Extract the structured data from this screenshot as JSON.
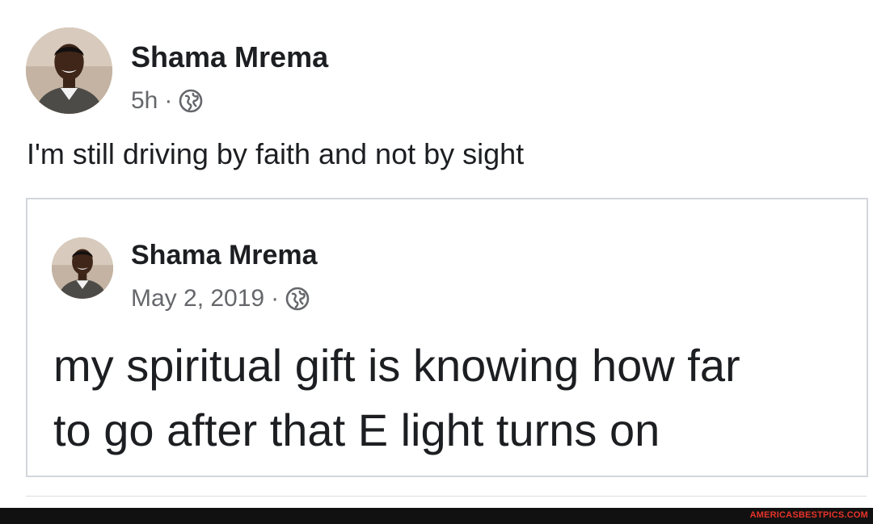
{
  "post": {
    "author": "Shama Mrema",
    "time": "5h",
    "separator": "·",
    "privacy_icon": "globe-icon",
    "text": "I'm still driving by faith and not by sight",
    "shared": {
      "author": "Shama Mrema",
      "date": "May 2, 2019",
      "separator": "·",
      "privacy_icon": "globe-icon",
      "text_lines": [
        "my spiritual gift is knowing how far",
        "to go after that E light turns on"
      ]
    }
  },
  "watermark": "AMERICASBESTPICS.COM",
  "colors": {
    "text": "#1c1e21",
    "meta": "#65676b",
    "border": "#d3d6db",
    "footer_bg": "#111111",
    "watermark": "#e8332a"
  }
}
